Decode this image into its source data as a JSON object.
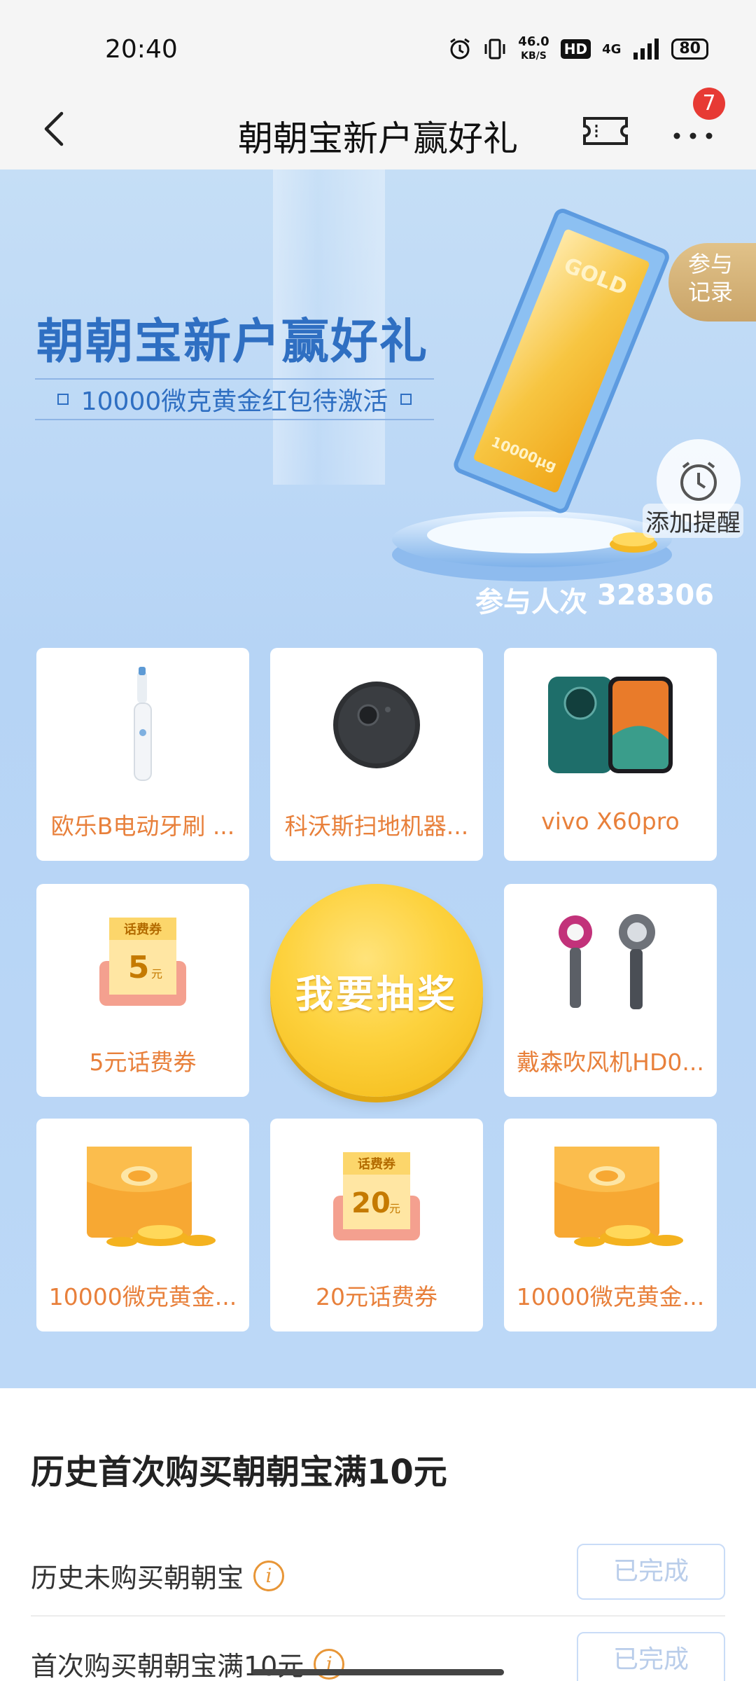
{
  "status_bar": {
    "time": "20:40",
    "net_speed_value": "46.0",
    "net_speed_unit": "KB/S",
    "hd": "HD",
    "network": "4G",
    "battery": "80"
  },
  "nav": {
    "title": "朝朝宝新户赢好礼",
    "badge": "7"
  },
  "banner": {
    "title": "朝朝宝新户赢好礼",
    "subtitle": "10000微克黄金红包待激活",
    "gold_text": "GOLD",
    "gold_weight": "10000μg",
    "participants_label": "参与人次",
    "participants_value": "328306",
    "record_button": "参与\n记录",
    "record_line1": "参与",
    "record_line2": "记录",
    "remind_button": "添加提醒"
  },
  "prizes": [
    {
      "label": "欧乐B电动牙刷 ...",
      "icon": "toothbrush-image"
    },
    {
      "label": "科沃斯扫地机器...",
      "icon": "robot-vacuum-image"
    },
    {
      "label": "vivo X60pro",
      "icon": "phone-image"
    },
    {
      "label": "5元话费券",
      "icon": "coupon-image",
      "coupon_title": "话费券",
      "coupon_amount": "5",
      "coupon_unit": "元"
    },
    {
      "label": "戴森吹风机HD0...",
      "icon": "hair-dryer-image"
    },
    {
      "label": "10000微克黄金...",
      "icon": "gold-envelope-image"
    },
    {
      "label": "20元话费券",
      "icon": "coupon-image",
      "coupon_title": "话费券",
      "coupon_amount": "20",
      "coupon_unit": "元"
    },
    {
      "label": "10000微克黄金...",
      "icon": "gold-envelope-image"
    }
  ],
  "draw_button": "我要抽奖",
  "tasks": {
    "title": "历史首次购买朝朝宝满10元",
    "items": [
      {
        "label": "历史未购买朝朝宝",
        "button": "已完成"
      },
      {
        "label": "首次购买朝朝宝满10元",
        "button": "已完成"
      }
    ]
  },
  "colors": {
    "accent_blue": "#2f6fc2",
    "prize_label": "#e8803b",
    "draw_button": "#fdd23e",
    "badge": "#e73a34"
  }
}
